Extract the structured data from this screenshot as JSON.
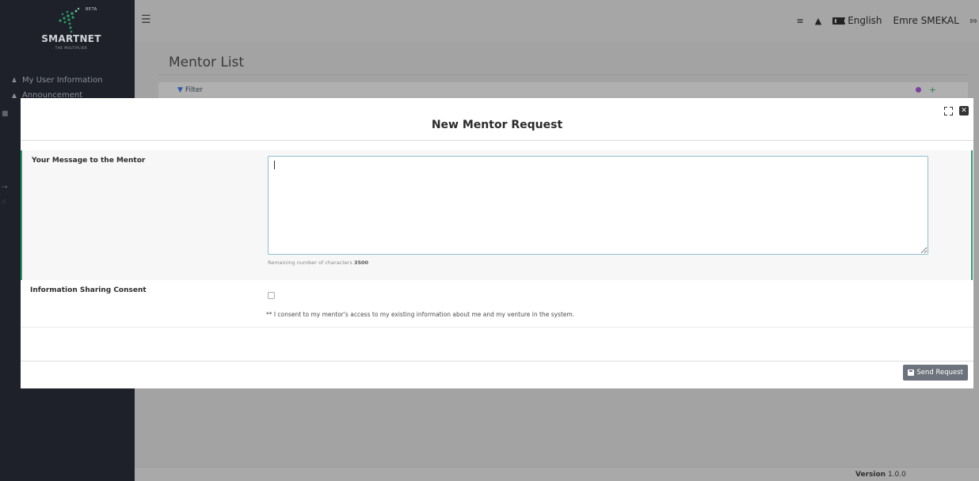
{
  "brand": {
    "beta": "BETA",
    "name": "SMARTNET",
    "tagline": "THE MULTIPLIER"
  },
  "sidebar": {
    "items": [
      {
        "label": "My User Information",
        "icon": "user-icon"
      },
      {
        "label": "Announcement",
        "icon": "megaphone-icon"
      }
    ]
  },
  "topbar": {
    "language": "English",
    "user_name": "Emre SMEKAL"
  },
  "page": {
    "title": "Mentor List",
    "filter_label": "Filter"
  },
  "modal": {
    "title": "New Mentor Request",
    "message_label": "Your Message to the Mentor",
    "message_value": "",
    "remaining_prefix": "Remaining number of characters",
    "remaining_count": "3500",
    "consent_label": "Information Sharing Consent",
    "consent_text": "** I consent to my mentor's access to my existing information about me and my venture in the system.",
    "consent_checked": false,
    "send_label": "Send Request"
  },
  "footer": {
    "version_label": "Version",
    "version_value": "1.0.0"
  },
  "colors": {
    "sidebar_bg": "#1e2129",
    "overlay_bg": "#a6a6a6",
    "accent_green": "#2e9c6a",
    "button_gray": "#6c737c"
  }
}
